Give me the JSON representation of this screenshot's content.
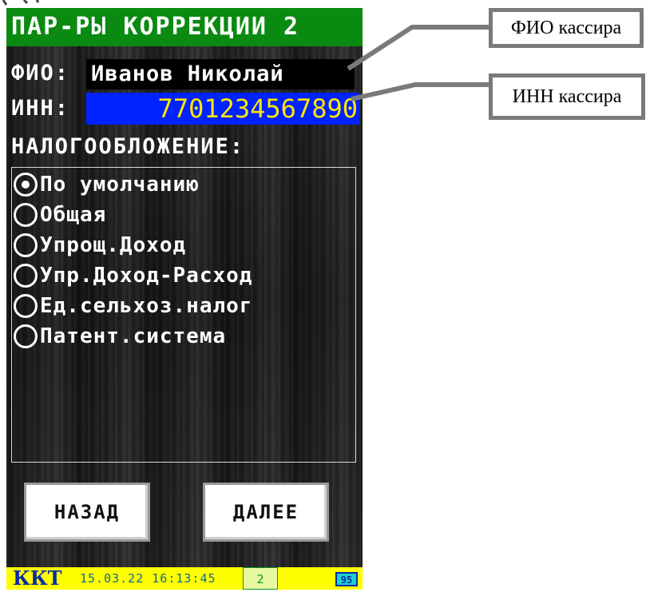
{
  "screen": {
    "title": "ПАР-РЫ КОРРЕКЦИИ 2",
    "fio_label": "ФИО:",
    "fio_value": "Иванов Николай",
    "inn_label": "ИНН:",
    "inn_value": "7701234567890",
    "taxation_label": "НАЛОГООБЛОЖЕНИЕ:",
    "tax_options": [
      {
        "label": "По умолчанию",
        "selected": true
      },
      {
        "label": "Общая",
        "selected": false
      },
      {
        "label": "Упрощ.Доход",
        "selected": false
      },
      {
        "label": "Упр.Доход-Расход",
        "selected": false
      },
      {
        "label": "Ед.сельхоз.налог",
        "selected": false
      },
      {
        "label": "Патент.система",
        "selected": false
      }
    ],
    "back_button": "НАЗАД",
    "next_button": "ДАЛЕЕ"
  },
  "status_bar": {
    "device": "ККТ",
    "datetime": "15.03.22 16:13:45",
    "counter": "2",
    "battery": "95"
  },
  "callouts": {
    "fio": "ФИО кассира",
    "inn": "ИНН кассира"
  },
  "colors": {
    "title_bg": "#0b8a12",
    "inn_bg": "#0022ff",
    "inn_text": "#ffe600",
    "status_bg": "#ffff00",
    "callout_border": "#7a7a7a"
  }
}
